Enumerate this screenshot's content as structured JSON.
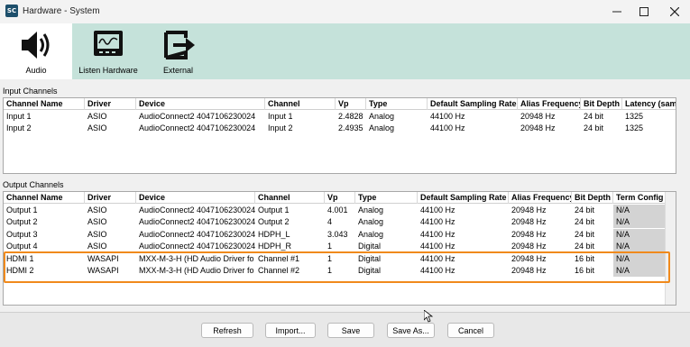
{
  "window": {
    "title": "Hardware - System",
    "app_icon_text": "SC"
  },
  "toolbar": {
    "audio": "Audio",
    "listen_hardware": "Listen Hardware",
    "external": "External"
  },
  "input_channels": {
    "section_label": "Input Channels",
    "columns": [
      "Channel Name",
      "Driver",
      "Device",
      "Channel",
      "Vp",
      "Type",
      "Default Sampling Rate",
      "Alias Frequency",
      "Bit Depth",
      "Latency (samp"
    ],
    "rows": [
      [
        "Input 1",
        "ASIO",
        "AudioConnect2 4047106230024",
        "Input 1",
        "2.4828",
        "Analog",
        "44100 Hz",
        "20948 Hz",
        "24 bit",
        "1325"
      ],
      [
        "Input 2",
        "ASIO",
        "AudioConnect2 4047106230024",
        "Input 2",
        "2.4935",
        "Analog",
        "44100 Hz",
        "20948 Hz",
        "24 bit",
        "1325"
      ]
    ]
  },
  "output_channels": {
    "section_label": "Output Channels",
    "columns": [
      "Channel Name",
      "Driver",
      "Device",
      "Channel",
      "Vp",
      "Type",
      "Default Sampling Rate",
      "Alias Frequency",
      "Bit Depth",
      "Term Config"
    ],
    "rows": [
      [
        "Output 1",
        "ASIO",
        "AudioConnect2 4047106230024",
        "Output 1",
        "4.001",
        "Analog",
        "44100 Hz",
        "20948 Hz",
        "24 bit",
        "N/A"
      ],
      [
        "Output 2",
        "ASIO",
        "AudioConnect2 4047106230024",
        "Output 2",
        "4",
        "Analog",
        "44100 Hz",
        "20948 Hz",
        "24 bit",
        "N/A"
      ],
      [
        "Output 3",
        "ASIO",
        "AudioConnect2 4047106230024",
        "HDPH_L",
        "3.043",
        "Analog",
        "44100 Hz",
        "20948 Hz",
        "24 bit",
        "N/A"
      ],
      [
        "Output 4",
        "ASIO",
        "AudioConnect2 4047106230024",
        "HDPH_R",
        "1",
        "Digital",
        "44100 Hz",
        "20948 Hz",
        "24 bit",
        "N/A"
      ],
      [
        "HDMI 1",
        "WASAPI",
        "MXX-M-3-H (HD Audio Driver fo",
        "Channel #1",
        "1",
        "Digital",
        "44100 Hz",
        "20948 Hz",
        "16 bit",
        "N/A"
      ],
      [
        "HDMI 2",
        "WASAPI",
        "MXX-M-3-H (HD Audio Driver fo",
        "Channel #2",
        "1",
        "Digital",
        "44100 Hz",
        "20948 Hz",
        "16 bit",
        "N/A"
      ]
    ]
  },
  "buttons": {
    "refresh": "Refresh",
    "import": "Import...",
    "save": "Save",
    "save_as": "Save As...",
    "cancel": "Cancel"
  },
  "colors": {
    "ribbon": "#c5e2da",
    "highlight": "#f08a1c",
    "term_config_cell": "#d3d3d3"
  }
}
